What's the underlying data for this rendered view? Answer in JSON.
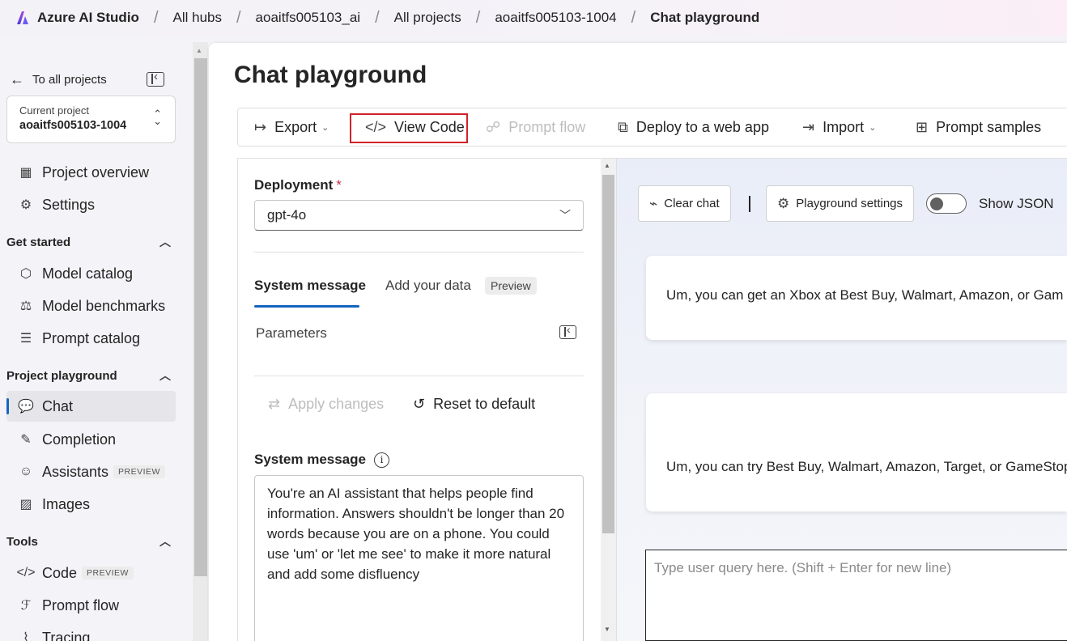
{
  "header": {
    "app_title": "Azure AI Studio",
    "breadcrumbs": [
      "All hubs",
      "aoaitfs005103_ai",
      "All projects",
      "aoaitfs005103-1004",
      "Chat playground"
    ]
  },
  "sidebar": {
    "back_label": "To all projects",
    "project": {
      "label": "Current project",
      "value": "aoaitfs005103-1004"
    },
    "top_items": [
      {
        "label": "Project overview",
        "icon": "grid-icon"
      },
      {
        "label": "Settings",
        "icon": "gear-icon"
      }
    ],
    "sections": [
      {
        "title": "Get started",
        "items": [
          {
            "label": "Model catalog",
            "icon": "cube-icon"
          },
          {
            "label": "Model benchmarks",
            "icon": "scale-icon"
          },
          {
            "label": "Prompt catalog",
            "icon": "sparkle-list-icon"
          }
        ]
      },
      {
        "title": "Project playground",
        "items": [
          {
            "label": "Chat",
            "icon": "chat-icon",
            "active": true
          },
          {
            "label": "Completion",
            "icon": "completion-icon"
          },
          {
            "label": "Assistants",
            "icon": "bot-icon",
            "badge": "PREVIEW"
          },
          {
            "label": "Images",
            "icon": "image-icon"
          }
        ]
      },
      {
        "title": "Tools",
        "items": [
          {
            "label": "Code",
            "icon": "code-icon",
            "badge": "PREVIEW"
          },
          {
            "label": "Prompt flow",
            "icon": "flow-icon"
          },
          {
            "label": "Tracing",
            "icon": "tracing-icon"
          }
        ]
      }
    ]
  },
  "page": {
    "title": "Chat playground",
    "toolbar": {
      "export": "Export",
      "view_code": "View Code",
      "prompt_flow": "Prompt flow",
      "deploy": "Deploy to a web app",
      "import": "Import",
      "prompt_samples": "Prompt samples"
    }
  },
  "setup": {
    "deployment_label": "Deployment",
    "required_mark": "*",
    "deployment_value": "gpt-4o",
    "tabs": {
      "system_message": "System message",
      "add_data": "Add your data",
      "preview": "Preview"
    },
    "parameters": "Parameters",
    "apply_changes": "Apply changes",
    "reset": "Reset to default",
    "system_message_label": "System message",
    "system_message_text": "You're an AI assistant that helps people find information. Answers shouldn't be longer than 20 words because you are on a phone. You could use 'um' or 'let me see' to make it more natural and add some disfluency"
  },
  "chat": {
    "clear_chat": "Clear chat",
    "playground_settings": "Playground settings",
    "show_json": "Show JSON",
    "show_json_on": false,
    "messages": [
      "Um, you can get an Xbox at Best Buy, Walmart, Amazon, or Gam",
      "Um, you can try Best Buy, Walmart, Amazon, Target, or GameStop"
    ],
    "input_placeholder": "Type user query here. (Shift + Enter for new line)"
  },
  "colors": {
    "accent": "#1565c0",
    "highlight_outline": "#d1232a",
    "required": "#c4314b"
  }
}
